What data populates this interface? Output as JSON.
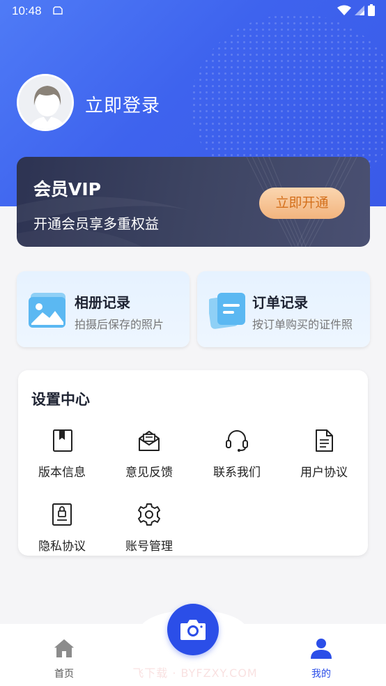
{
  "status": {
    "time": "10:48"
  },
  "profile": {
    "login_text": "立即登录"
  },
  "vip": {
    "title": "会员VIP",
    "subtitle": "开通会员享多重权益",
    "button": "立即开通"
  },
  "records": [
    {
      "title": "相册记录",
      "subtitle": "拍摄后保存的照片",
      "icon": "album-icon"
    },
    {
      "title": "订单记录",
      "subtitle": "按订单购买的证件照",
      "icon": "order-icon"
    }
  ],
  "settings": {
    "title": "设置中心",
    "items": [
      {
        "label": "版本信息",
        "icon": "bookmark-book-icon"
      },
      {
        "label": "意见反馈",
        "icon": "mail-feedback-icon"
      },
      {
        "label": "联系我们",
        "icon": "headset-icon"
      },
      {
        "label": "用户协议",
        "icon": "document-icon"
      },
      {
        "label": "隐私协议",
        "icon": "privacy-lock-icon"
      },
      {
        "label": "账号管理",
        "icon": "gear-icon"
      }
    ]
  },
  "tabbar": {
    "home": "首页",
    "mine": "我的",
    "active": "mine",
    "active_color": "#2b4ee8",
    "inactive_color": "#555555"
  },
  "watermark": "飞下载 · BYFZXY.COM"
}
